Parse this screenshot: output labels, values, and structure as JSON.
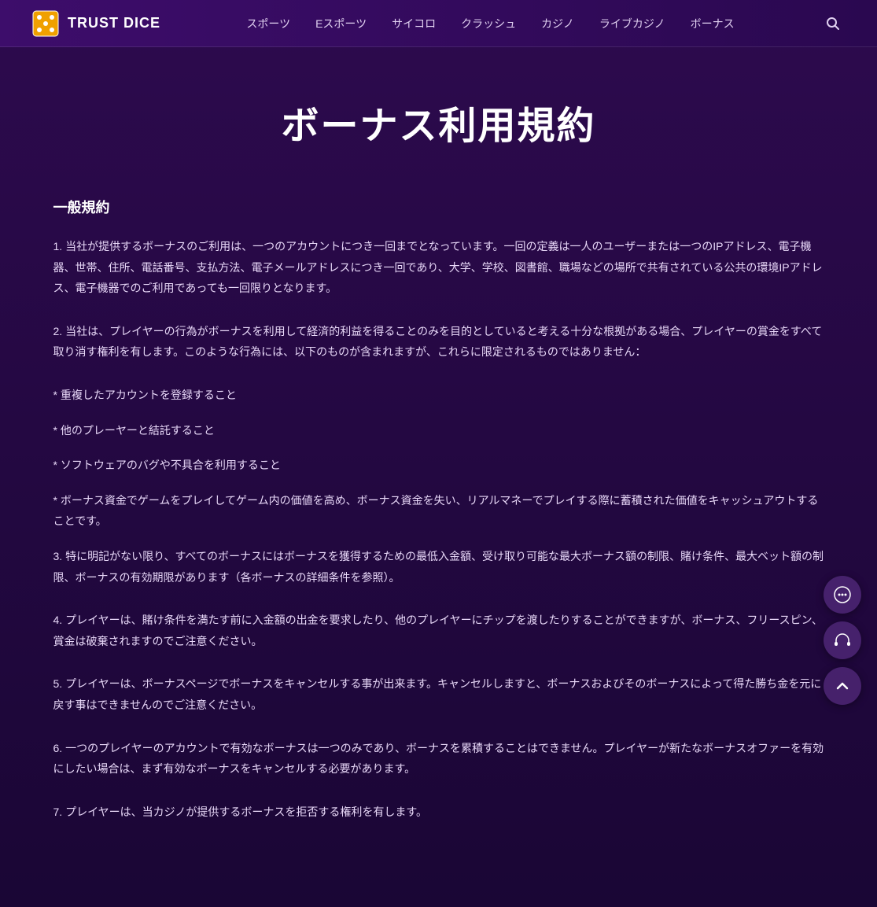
{
  "header": {
    "logo_text": "TRUST DICE",
    "nav_items": [
      {
        "label": "スポーツ",
        "id": "sports"
      },
      {
        "label": "Eスポーツ",
        "id": "esports"
      },
      {
        "label": "サイコロ",
        "id": "dice"
      },
      {
        "label": "クラッシュ",
        "id": "crash"
      },
      {
        "label": "カジノ",
        "id": "casino"
      },
      {
        "label": "ライブカジノ",
        "id": "live-casino"
      },
      {
        "label": "ボーナス",
        "id": "bonus"
      }
    ]
  },
  "page": {
    "title": "ボーナス利用規約",
    "section_title": "一般規約",
    "paragraphs": [
      {
        "id": "para1",
        "text": "1. 当社が提供するボーナスのご利用は、一つのアカウントにつき一回までとなっています。一回の定義は一人のユーザーまたは一つのIPアドレス、電子機器、世帯、住所、電話番号、支払方法、電子メールアドレスにつき一回であり、大学、学校、図書館、職場などの場所で共有されている公共の環境IPアドレス、電子機器でのご利用であっても一回限りとなります。"
      },
      {
        "id": "para2",
        "text": "2. 当社は、プレイヤーの行為がボーナスを利用して経済的利益を得ることのみを目的としていると考える十分な根拠がある場合、プレイヤーの賞金をすべて取り消す権利を有します。このような行為には、以下のものが含まれますが、これらに限定されるものではありません："
      },
      {
        "id": "listitem1",
        "text": "* 重複したアカウントを登録すること"
      },
      {
        "id": "listitem2",
        "text": "* 他のプレーヤーと結託すること"
      },
      {
        "id": "listitem3",
        "text": "* ソフトウェアのバグや不具合を利用すること"
      },
      {
        "id": "listitem4",
        "text": "* ボーナス資金でゲームをプレイしてゲーム内の価値を高め、ボーナス資金を失い、リアルマネーでプレイする際に蓄積された価値をキャッシュアウトすることです。"
      },
      {
        "id": "para3",
        "text": "3. 特に明記がない限り、すべてのボーナスにはボーナスを獲得するための最低入金額、受け取り可能な最大ボーナス額の制限、賭け条件、最大ベット額の制限、ボーナスの有効期限があります（各ボーナスの詳細条件を参照）。"
      },
      {
        "id": "para4",
        "text": "4. プレイヤーは、賭け条件を満たす前に入金額の出金を要求したり、他のプレイヤーにチップを渡したりすることができますが、ボーナス、フリースピン、賞金は破棄されますのでご注意ください。"
      },
      {
        "id": "para5",
        "text": "5. プレイヤーは、ボーナスページでボーナスをキャンセルする事が出来ます。キャンセルしますと、ボーナスおよびそのボーナスによって得た勝ち金を元に戻す事はできませんのでご注意ください。"
      },
      {
        "id": "para6",
        "text": "6. 一つのプレイヤーのアカウントで有効なボーナスは一つのみであり、ボーナスを累積することはできません。プレイヤーが新たなボーナスオファーを有効にしたい場合は、まず有効なボーナスをキャンセルする必要があります。"
      },
      {
        "id": "para7",
        "text": "7. プレイヤーは、当カジノが提供するボーナスを拒否する権利を有します。"
      }
    ]
  },
  "floats": {
    "chat_icon": "💬",
    "support_icon": "🎧",
    "scroll_top_icon": "∧"
  }
}
